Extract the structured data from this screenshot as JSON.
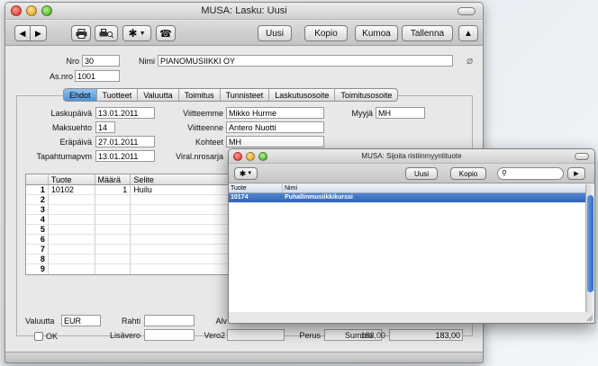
{
  "main": {
    "title": "MUSA: Lasku: Uusi",
    "toolbar": {
      "new": "Uusi",
      "copy": "Kopio",
      "cancel": "Kumoa",
      "save": "Tallenna"
    },
    "header": {
      "nro_label": "Nro",
      "nro": "30",
      "nimi_label": "Nimi",
      "nimi": "PIANOMUSIIKKI OY",
      "asnro_label": "As.nro",
      "asnro": "1001"
    },
    "tabs": [
      "Ehdot",
      "Tuotteet",
      "Valuutta",
      "Toimitus",
      "Tunnisteet",
      "Laskutusosoite",
      "Toimitusosoite"
    ],
    "terms": {
      "laskupaiva_label": "Laskupäivä",
      "laskupaiva": "13.01.2011",
      "maksuehto_label": "Maksuehto",
      "maksuehto": "14",
      "erapaiva_label": "Eräpäivä",
      "erapaiva": "27.01.2011",
      "tapahtumapvm_label": "Tapahtumapvm",
      "tapahtumapvm": "13.01.2011",
      "viitteemme_label": "Viitteemme",
      "viitteemme": "Mikko Hurme",
      "viitteenne_label": "Viitteenne",
      "viitteenne": "Antero Nuotti",
      "kohteet_label": "Kohteet",
      "kohteet": "MH",
      "viralnrosarja_label": "Viral.nrosarja",
      "myyja_label": "Myyjä",
      "myyja": "MH"
    },
    "matrix": {
      "headers": [
        "",
        "Tuote",
        "Määrä",
        "Selite"
      ],
      "rows": [
        {
          "n": "1",
          "tuote": "10102",
          "maara": "1",
          "selite": "Huilu"
        },
        {
          "n": "2",
          "tuote": "",
          "maara": "",
          "selite": ""
        },
        {
          "n": "3",
          "tuote": "",
          "maara": "",
          "selite": ""
        },
        {
          "n": "4",
          "tuote": "",
          "maara": "",
          "selite": ""
        },
        {
          "n": "5",
          "tuote": "",
          "maara": "",
          "selite": ""
        },
        {
          "n": "6",
          "tuote": "",
          "maara": "",
          "selite": ""
        },
        {
          "n": "7",
          "tuote": "",
          "maara": "",
          "selite": ""
        },
        {
          "n": "8",
          "tuote": "",
          "maara": "",
          "selite": ""
        },
        {
          "n": "9",
          "tuote": "",
          "maara": "",
          "selite": ""
        }
      ]
    },
    "footer": {
      "valuutta_label": "Valuutta",
      "valuutta": "EUR",
      "rahti_label": "Rahti",
      "alv_label": "Alv",
      "ok_label": "OK",
      "lisavero_label": "Lisävero",
      "vero2_label": "Vero2",
      "perus_label": "Perus",
      "summa_label": "Summa",
      "summa_value": "183,00",
      "total": "183,00"
    }
  },
  "popup": {
    "title": "MUSA: Sijoita ristiinmyyntituote",
    "new": "Uusi",
    "copy": "Kopio",
    "search_placeholder": "",
    "col_tuote": "Tuote",
    "col_nimi": "Nimi",
    "rows": [
      {
        "tuote": "10174",
        "nimi": "Puhallinmusiikkikurssi"
      }
    ]
  }
}
